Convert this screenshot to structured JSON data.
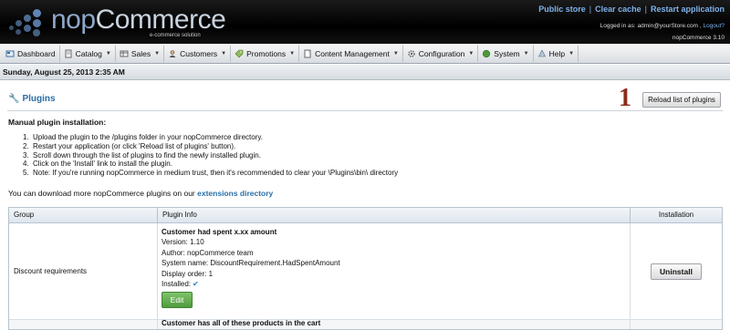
{
  "header": {
    "brand_prefix": "nop",
    "brand_suffix": "Commerce",
    "tagline": "e-commerce solution",
    "links": [
      "Public store",
      "Clear cache",
      "Restart application"
    ],
    "logged_in_label": "Logged in as: admin@yourStore.com ,",
    "logout_label": "Logout?",
    "version": "nopCommerce 3.10"
  },
  "menu": [
    {
      "label": "Dashboard",
      "icon": "dashboard-icon",
      "dropdown": false
    },
    {
      "label": "Catalog",
      "icon": "catalog-icon",
      "dropdown": true
    },
    {
      "label": "Sales",
      "icon": "sales-icon",
      "dropdown": true
    },
    {
      "label": "Customers",
      "icon": "customers-icon",
      "dropdown": true
    },
    {
      "label": "Promotions",
      "icon": "promotions-icon",
      "dropdown": true
    },
    {
      "label": "Content Management",
      "icon": "content-icon",
      "dropdown": true
    },
    {
      "label": "Configuration",
      "icon": "configuration-icon",
      "dropdown": true
    },
    {
      "label": "System",
      "icon": "system-icon",
      "dropdown": true
    },
    {
      "label": "Help",
      "icon": "help-icon",
      "dropdown": true
    }
  ],
  "date": "Sunday, August 25, 2013 2:35 AM",
  "page": {
    "title": "Plugins",
    "reload_button": "Reload list of plugins",
    "annotation": "1",
    "manual_title": "Manual plugin installation:",
    "steps": [
      "Upload the plugin to the /plugins folder in your nopCommerce directory.",
      "Restart your application (or click 'Reload list of plugins' button).",
      "Scroll down through the list of plugins to find the newly installed plugin.",
      "Click on the 'Install' link to install the plugin.",
      "Note: If you're running nopCommerce in medium trust, then it's recommended to clear your \\Plugins\\bin\\ directory"
    ],
    "download_text": "You can download more nopCommerce plugins on our",
    "download_link": "extensions directory"
  },
  "table": {
    "headers": [
      "Group",
      "Plugin Info",
      "Installation"
    ],
    "rows": [
      {
        "group": "Discount requirements",
        "title": "Customer had spent x.xx amount",
        "version": "Version: 1.10",
        "author": "Author: nopCommerce team",
        "system_name": "System name: DiscountRequirement.HadSpentAmount",
        "display_order": "Display order: 1",
        "installed": "Installed:",
        "edit_label": "Edit",
        "action_label": "Uninstall"
      }
    ],
    "next_row_title": "Customer has all of these products in the cart"
  },
  "colors": {
    "accent_link": "#2a6fa8",
    "header_link": "#7fb2ea",
    "edit_green": "#5aa846",
    "annotation": "#8a2d1c"
  }
}
